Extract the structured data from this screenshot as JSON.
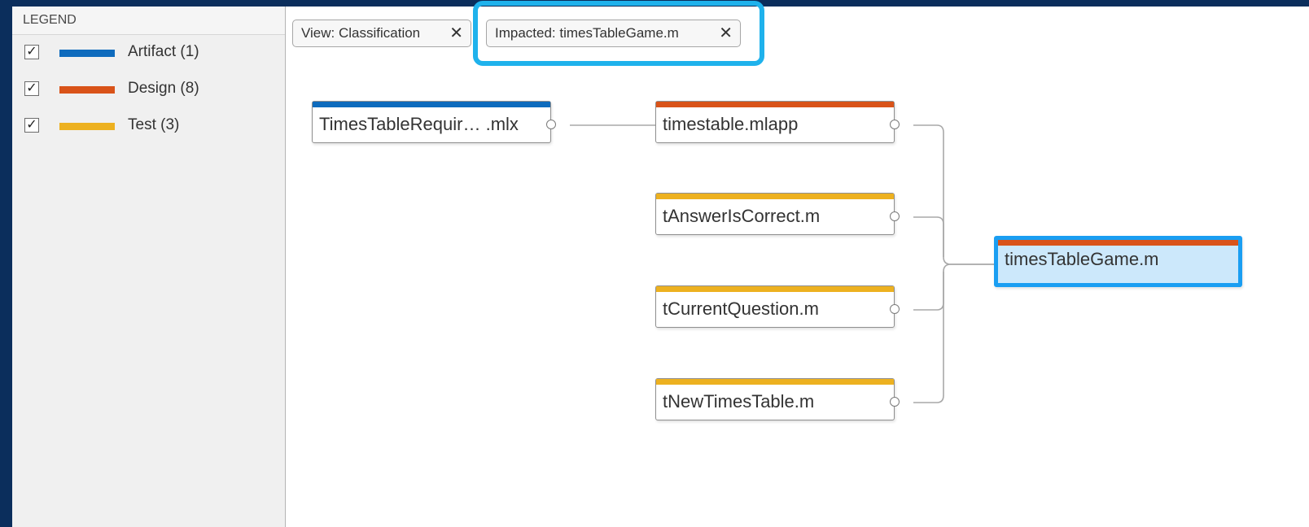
{
  "legend": {
    "header": "LEGEND",
    "items": [
      {
        "label": "Artifact (1)",
        "color": "#0e6bbd",
        "checked": "✓"
      },
      {
        "label": "Design (8)",
        "color": "#d95319",
        "checked": "✓"
      },
      {
        "label": "Test (3)",
        "color": "#edb120",
        "checked": "✓"
      }
    ]
  },
  "filters": {
    "view_chip": {
      "label": "View: Classification",
      "close": "✕"
    },
    "impacted_chip": {
      "label": "Impacted: timesTableGame.m",
      "close": "✕"
    }
  },
  "graph": {
    "nodes": {
      "req": {
        "name": "TimesTableRequir… .mlx",
        "category": "Artifact"
      },
      "app": {
        "name": "timestable.mlapp",
        "category": "Design"
      },
      "t1": {
        "name": "tAnswerIsCorrect.m",
        "category": "Test"
      },
      "t2": {
        "name": "tCurrentQuestion.m",
        "category": "Test"
      },
      "t3": {
        "name": "tNewTimesTable.m",
        "category": "Test"
      },
      "game": {
        "name": "timesTableGame.m",
        "category": "Design",
        "selected": true
      }
    },
    "edge_color": "#a8a8a8",
    "selected_color": "#1a9ef2",
    "highlight_color": "#1fb2ec"
  }
}
